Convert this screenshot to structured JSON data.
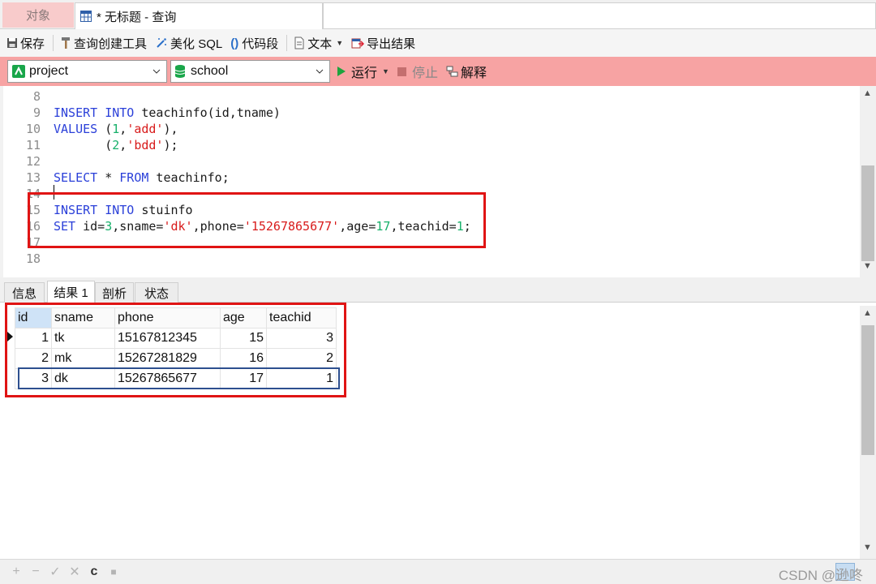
{
  "tabs": {
    "objects_label": "对象",
    "query_label": "* 无标题 - 查询"
  },
  "toolbar": {
    "save": "保存",
    "query_builder": "查询创建工具",
    "beautify_sql": "美化 SQL",
    "code_snippet": "代码段",
    "text": "文本",
    "export_result": "导出结果"
  },
  "connection": {
    "connection_name": "project",
    "database_name": "school",
    "run": "运行",
    "stop": "停止",
    "explain": "解释"
  },
  "editor": {
    "lines": [
      {
        "n": "8"
      },
      {
        "n": "9"
      },
      {
        "n": "10"
      },
      {
        "n": "11"
      },
      {
        "n": "12"
      },
      {
        "n": "13"
      },
      {
        "n": "14"
      },
      {
        "n": "15"
      },
      {
        "n": "16"
      },
      {
        "n": "17"
      },
      {
        "n": "18"
      }
    ],
    "code": {
      "l9_kw1": "INSERT",
      "l9_kw2": "INTO",
      "l9_rest": " teachinfo(id,tname)",
      "l10_kw": "VALUES",
      "l10_a": " (",
      "l10_n": "1",
      "l10_b": ",",
      "l10_s": "'add'",
      "l10_c": "),",
      "l11_a": "       (",
      "l11_n": "2",
      "l11_b": ",",
      "l11_s": "'bdd'",
      "l11_c": ");",
      "l13_kw1": "SELECT",
      "l13_mid": " * ",
      "l13_kw2": "FROM",
      "l13_rest": " teachinfo;",
      "l15_kw1": "INSERT",
      "l15_kw2": "INTO",
      "l15_rest": " stuinfo",
      "l16_kw": "SET",
      "l16_a": " id=",
      "l16_n1": "3",
      "l16_b": ",sname=",
      "l16_s1": "'dk'",
      "l16_c": ",phone=",
      "l16_s2": "'15267865677'",
      "l16_d": ",age=",
      "l16_n2": "17",
      "l16_e": ",teachid=",
      "l16_n3": "1",
      "l16_f": ";"
    }
  },
  "result_tabs": [
    "信息",
    "结果 1",
    "剖析",
    "状态"
  ],
  "result": {
    "columns": [
      "id",
      "sname",
      "phone",
      "age",
      "teachid"
    ],
    "rows": [
      [
        "1",
        "tk",
        "15167812345",
        "15",
        "3"
      ],
      [
        "2",
        "mk",
        "15267281829",
        "16",
        "2"
      ],
      [
        "3",
        "dk",
        "15267865677",
        "17",
        "1"
      ]
    ]
  },
  "statusbar": {
    "add": "+",
    "remove": "−",
    "apply": "✓",
    "discard": "✕",
    "refresh": "c",
    "stop": "■",
    "watermark": "CSDN @逊咚"
  },
  "colors": {
    "accent_red": "#e01414",
    "connbar_bg": "#f7a3a3",
    "keyword": "#2b40d9",
    "string": "#d81b1b",
    "number": "#17b06a",
    "row_highlight": "#2d4f8f"
  }
}
